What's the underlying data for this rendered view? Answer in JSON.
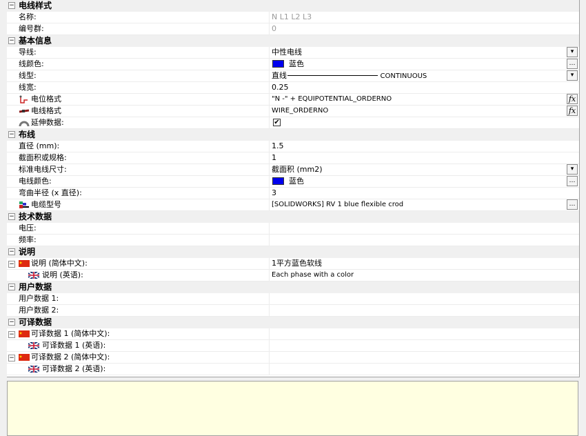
{
  "colors": {
    "blue_swatch": "#0000ee",
    "description_bg": "#ffffe1",
    "category_bg": "#f0f0f0"
  },
  "toggle_symbol": "−",
  "checkbox_symbol": "✔",
  "button_labels": {
    "dropdown": "▾",
    "ellipsis": "…",
    "formula": "fx"
  },
  "sections": {
    "wire_style": {
      "title": "电线样式",
      "name_label": "名称:",
      "name_value": "N L1 L2 L3",
      "number_group_label": "编号群:",
      "number_group_value": "0"
    },
    "basic_info": {
      "title": "基本信息",
      "conductor_label": "导线:",
      "conductor_value": "中性电线",
      "line_color_label": "线颜色:",
      "line_color_value": "蓝色",
      "line_type_label": "线型:",
      "line_type_prefix": "直线",
      "line_type_value": "CONTINUOUS",
      "line_width_label": "线宽:",
      "line_width_value": "0.25",
      "potential_format_label": "电位格式",
      "potential_format_value": "\"N -\" + EQUIPOTENTIAL_ORDERNO",
      "wire_format_label": "电线格式",
      "wire_format_value": "WIRE_ORDERNO",
      "extended_data_label": "延伸数据:"
    },
    "wiring": {
      "title": "布线",
      "diameter_label": "直径 (mm):",
      "diameter_value": "1.5",
      "cross_section_label": "截面积或规格:",
      "cross_section_value": "1",
      "standard_size_label": "标准电线尺寸:",
      "standard_size_value": "截面积 (mm2)",
      "wire_color_label": "电线颜色:",
      "wire_color_value": "蓝色",
      "bend_radius_label": "弯曲半径 (x 直径):",
      "bend_radius_value": "3",
      "cable_type_label": "电缆型号",
      "cable_type_value": "[SOLIDWORKS] RV 1 blue flexible crod"
    },
    "tech_data": {
      "title": "技术数据",
      "voltage_label": "电压:",
      "voltage_value": "",
      "frequency_label": "频率:",
      "frequency_value": ""
    },
    "description": {
      "title": "说明",
      "zh_label": "说明 (简体中文):",
      "zh_value": "1平方蓝色软线",
      "en_label": "说明 (英语):",
      "en_value": "Each phase with a color"
    },
    "user_data": {
      "title": "用户数据",
      "ud1_label": "用户数据 1:",
      "ud1_value": "",
      "ud2_label": "用户数据 2:",
      "ud2_value": ""
    },
    "translatable_data": {
      "title": "可译数据",
      "td1_zh_label": "可译数据 1 (简体中文):",
      "td1_en_label": "可译数据 1 (英语):",
      "td2_zh_label": "可译数据 2 (简体中文):",
      "td2_en_label": "可译数据 2 (英语):"
    }
  }
}
